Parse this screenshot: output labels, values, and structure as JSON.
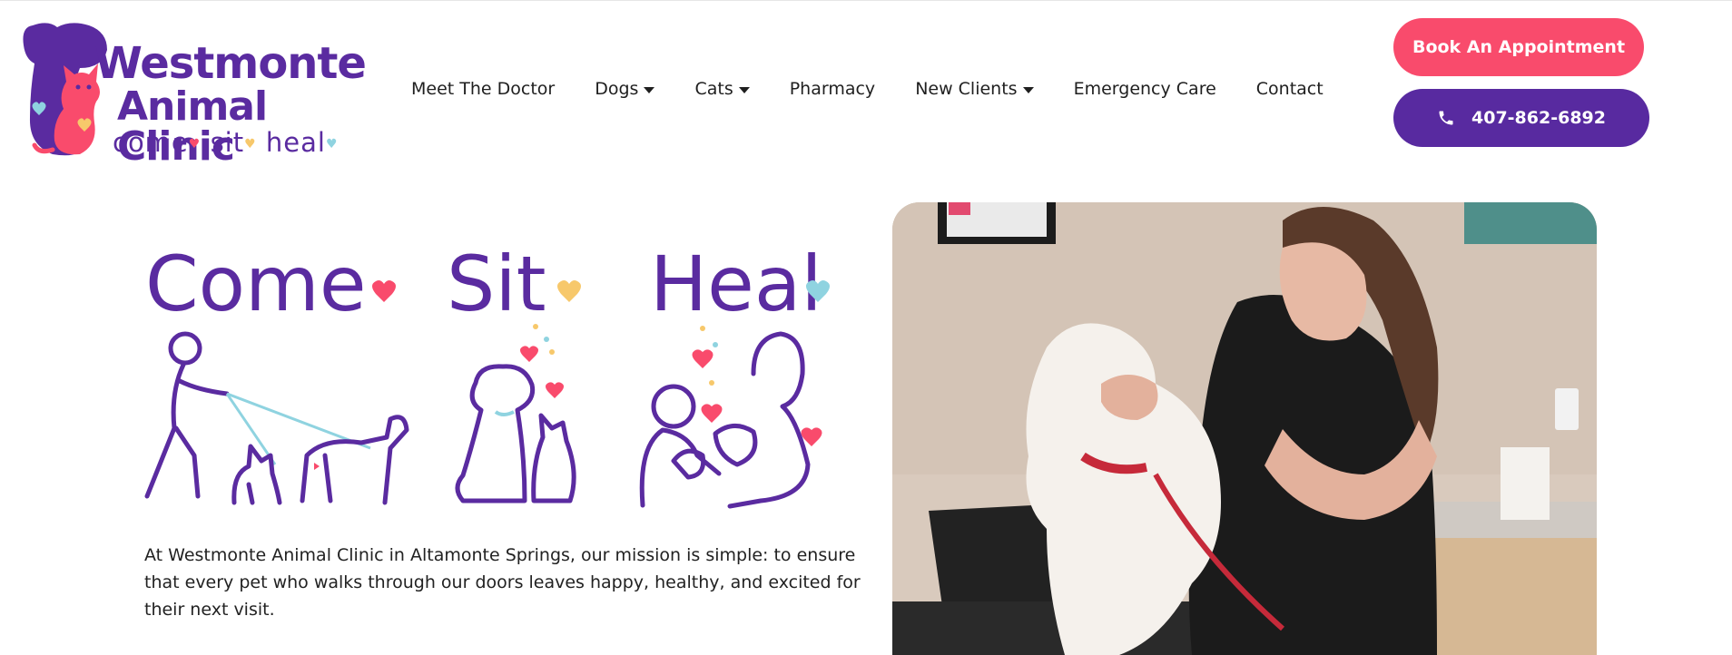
{
  "brand": {
    "name_line1": "Westmonte",
    "name_line2": "Animal Clinic",
    "tagline_words": [
      "come",
      "sit",
      "heal"
    ]
  },
  "nav": {
    "items": [
      {
        "label": "Meet The Doctor",
        "dropdown": false
      },
      {
        "label": "Dogs",
        "dropdown": true
      },
      {
        "label": "Cats",
        "dropdown": true
      },
      {
        "label": "Pharmacy",
        "dropdown": false
      },
      {
        "label": "New Clients",
        "dropdown": true
      },
      {
        "label": "Emergency Care",
        "dropdown": false
      },
      {
        "label": "Contact",
        "dropdown": false
      }
    ]
  },
  "cta": {
    "book_label": "Book An Appointment",
    "phone_label": "407-862-6892"
  },
  "hero": {
    "words": [
      "Come",
      "Sit",
      "Heal"
    ],
    "mission": "At Westmonte Animal Clinic in Altamonte Springs, our mission is simple: to ensure that every pet who walks through our doors leaves happy, healthy, and excited for their next visit."
  },
  "colors": {
    "purple": "#582aa0",
    "pink": "#f94b6c",
    "gold": "#f7c86b",
    "aqua": "#8fd3e0"
  },
  "icons": {
    "phone": "phone-icon",
    "caret": "caret-down-icon",
    "heart": "heart-icon"
  }
}
